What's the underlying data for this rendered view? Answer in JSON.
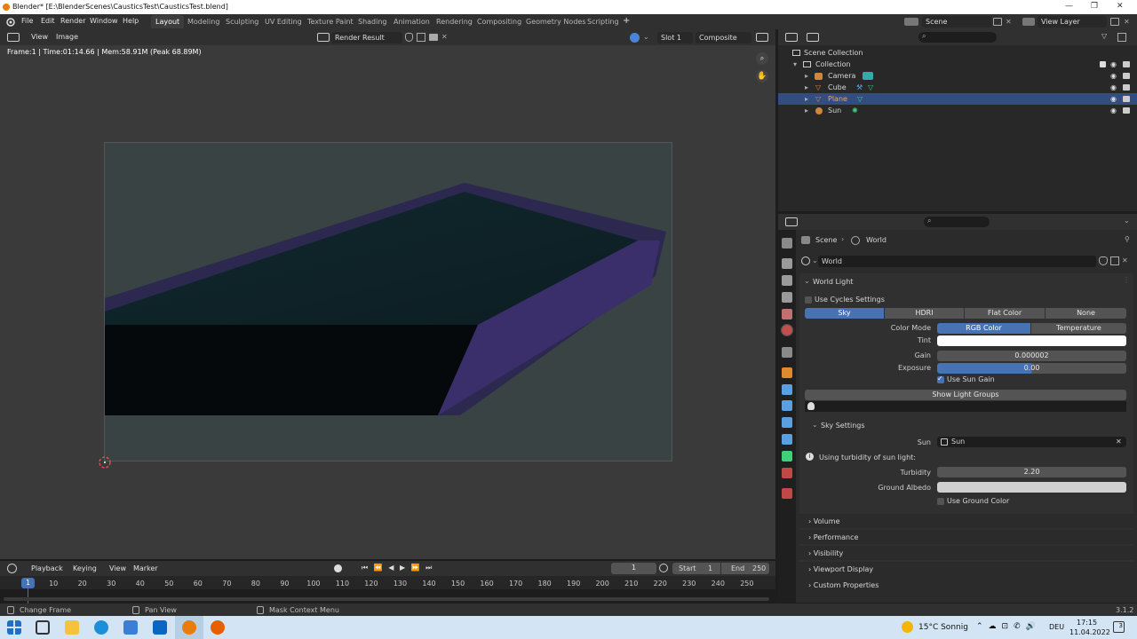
{
  "titlebar": {
    "title": "Blender* [E:\\BlenderScenes\\CausticsTest\\CausticsTest.blend]",
    "minimize": "—",
    "maximize": "❐",
    "close": "✕"
  },
  "menu": [
    "File",
    "Edit",
    "Render",
    "Window",
    "Help"
  ],
  "workspaces": [
    "Layout",
    "Modeling",
    "Sculpting",
    "UV Editing",
    "Texture Paint",
    "Shading",
    "Animation",
    "Rendering",
    "Compositing",
    "Geometry Nodes",
    "Scripting"
  ],
  "active_workspace": "Layout",
  "add_workspace": "+",
  "scene": "Scene",
  "view_layer": "View Layer",
  "image_editor": {
    "view": "View",
    "image": "Image",
    "image_name": "Render Result",
    "slot": "Slot 1",
    "pass": "Composite",
    "info": "Frame:1 | Time:01:14.66 | Mem:58.91M (Peak 68.89M)"
  },
  "outliner": {
    "scene_collection": "Scene Collection",
    "collection": "Collection",
    "items": [
      {
        "name": "Camera",
        "selected": false,
        "color": "#e0a050"
      },
      {
        "name": "Cube",
        "selected": false,
        "color": "#e0a050"
      },
      {
        "name": "Plane",
        "selected": true,
        "color": "#e0a050"
      },
      {
        "name": "Sun",
        "selected": false,
        "color": "#e0a050"
      }
    ]
  },
  "properties": {
    "breadcrumb_scene": "Scene",
    "breadcrumb_world": "World",
    "world_name": "World",
    "panel_world_light": "World Light",
    "use_cycles": "Use Cycles Settings",
    "light_tabs": [
      "Sky",
      "HDRI",
      "Flat Color",
      "None"
    ],
    "active_light_tab": "Sky",
    "color_mode_label": "Color Mode",
    "color_mode_options": [
      "RGB Color",
      "Temperature"
    ],
    "active_color_mode": "RGB Color",
    "tint_label": "Tint",
    "tint_color": "#ffffff",
    "gain_label": "Gain",
    "gain_value": "0.000002",
    "exposure_label": "Exposure",
    "exposure_value": "0.00",
    "use_sun_gain": "Use Sun Gain",
    "show_light_groups": "Show Light Groups",
    "sky_settings": "Sky Settings",
    "sun_label": "Sun",
    "sun_value": "Sun",
    "turbidity_info": "Using turbidity of sun light:",
    "turbidity_label": "Turbidity",
    "turbidity_value": "2.20",
    "ground_albedo_label": "Ground Albedo",
    "use_ground_color": "Use Ground Color",
    "collapsed_panels": [
      "Volume",
      "Performance",
      "Visibility",
      "Viewport Display",
      "Custom Properties"
    ]
  },
  "timeline": {
    "playback": "Playback",
    "keying": "Keying",
    "view": "View",
    "marker": "Marker",
    "current_frame": "1",
    "start_label": "Start",
    "start_value": "1",
    "end_label": "End",
    "end_value": "250",
    "ticks": [
      "10",
      "20",
      "30",
      "40",
      "50",
      "60",
      "70",
      "80",
      "90",
      "100",
      "110",
      "120",
      "130",
      "140",
      "150",
      "160",
      "170",
      "180",
      "190",
      "200",
      "210",
      "220",
      "230",
      "240",
      "250"
    ],
    "cursor_frame": "1"
  },
  "status": {
    "left": "Change Frame",
    "middle": "Pan View",
    "right": "Mask Context Menu",
    "version": "3.1.2"
  },
  "taskbar": {
    "weather": "15°C Sonnig",
    "lang": "DEU",
    "time": "17:15",
    "date": "11.04.2022",
    "notifications": "3"
  }
}
